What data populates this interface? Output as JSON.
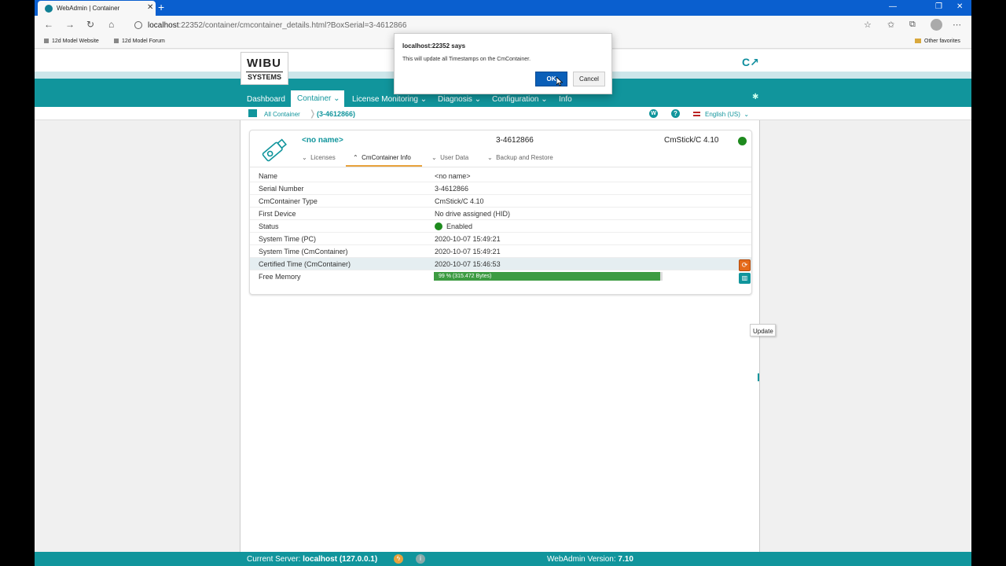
{
  "browser": {
    "tab_title": "WebAdmin | Container",
    "tab_close": "✕",
    "new_tab": "+",
    "url_host": "localhost",
    "url_rest": ":22352/container/cmcontainer_details.html?BoxSerial=3-4612866",
    "bookmarks": [
      "12d Model Website",
      "12d Model Forum"
    ],
    "other_favorites": "Other favorites"
  },
  "app": {
    "logo_top": "WIBU",
    "logo_bottom": "SYSTEMS",
    "menu": {
      "dashboard": "Dashboard",
      "container": "Container ⌄",
      "license_monitoring": "License Monitoring ⌄",
      "diagnosis": "Diagnosis ⌄",
      "configuration": "Configuration ⌄",
      "info": "Info"
    },
    "breadcrumb": {
      "all": "All Container",
      "serial": "(3-4612866)"
    },
    "language": "English (US)"
  },
  "card": {
    "name": "<no name>",
    "serial": "3-4612866",
    "type": "CmStick/C 4.10",
    "tabs": [
      "Licenses",
      "CmContainer Info",
      "User Data",
      "Backup and Restore"
    ],
    "rows": [
      {
        "key": "Name",
        "value": "<no name>"
      },
      {
        "key": "Serial Number",
        "value": "3-4612866"
      },
      {
        "key": "CmContainer Type",
        "value": "CmStick/C 4.10"
      },
      {
        "key": "First Device",
        "value": "No drive assigned (HID)"
      },
      {
        "key": "Status",
        "value": "Enabled"
      },
      {
        "key": "System Time (PC)",
        "value": "2020-10-07 15:49:21"
      },
      {
        "key": "System Time (CmContainer)",
        "value": "2020-10-07 15:49:21"
      },
      {
        "key": "Certified Time (CmContainer)",
        "value": "2020-10-07 15:46:53"
      },
      {
        "key": "Free Memory",
        "value": "99 % (315.472 Bytes)"
      }
    ],
    "free_memory_fraction": 0.99,
    "tooltip": "Update"
  },
  "footer": {
    "server_label": "Current Server:",
    "server_value": "localhost (127.0.0.1)",
    "version_label": "WebAdmin Version:",
    "version_value": "7.10"
  },
  "dialog": {
    "title": "localhost:22352 says",
    "message": "This will update all Timestamps on the CmContainer.",
    "ok": "OK",
    "cancel": "Cancel"
  },
  "colors": {
    "accent": "#11959c",
    "status_green": "#1e8a1e",
    "memory_fill": "#3d9b42",
    "update_button": "#e56a1a",
    "dialog_primary": "#0a5fb8"
  }
}
